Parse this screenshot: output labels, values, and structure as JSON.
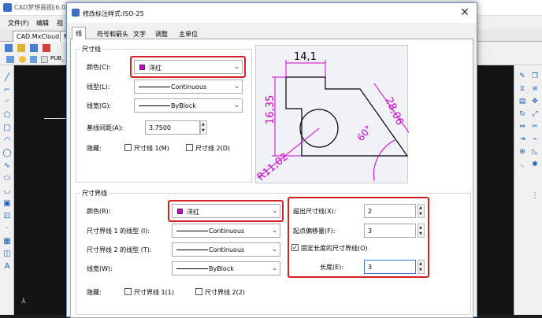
{
  "app": {
    "title": "CAD梦想画图(6.0.2",
    "menu": [
      "文件(F)",
      "编辑",
      "视"
    ],
    "doc_tabs": [
      "CAD.MxCloud",
      "M"
    ],
    "layer_name": "PUB_"
  },
  "dialog": {
    "title": "修改标注样式:ISO-25",
    "close_symbol": "✕",
    "tabs": [
      "线",
      "符号和箭头",
      "文字",
      "调整",
      "主单位"
    ],
    "active_tab": "线",
    "dimline": {
      "group_label": "尺寸线",
      "color_label": "颜色(C):",
      "color_value": "洋红",
      "color_hex": "#cc00cc",
      "linetype_label": "线型(L):",
      "linetype_value": "Continuous",
      "lineweight_label": "线宽(G):",
      "lineweight_value": "ByBlock",
      "baseline_label": "基线间距(A):",
      "baseline_value": "3.7500",
      "suppress_label": "隐藏:",
      "suppress_1": "尺寸线 1(M)",
      "suppress_2": "尺寸线 2(D)"
    },
    "extline": {
      "group_label": "尺寸界线",
      "color_label": "颜色(R):",
      "color_value": "洋红",
      "linetype1_label": "尺寸界线 1 的线型 (I):",
      "linetype1_value": "Continuous",
      "linetype2_label": "尺寸界线 2 的线型 (T):",
      "linetype2_value": "Continuous",
      "lineweight_label": "线宽(W):",
      "lineweight_value": "ByBlock",
      "suppress_label": "隐藏:",
      "suppress_1": "尺寸界线 1(1)",
      "suppress_2": "尺寸界线 2(2)",
      "extend_label": "超出尺寸线(X):",
      "extend_value": "2",
      "offset_label": "起点偏移量(F):",
      "offset_value": "3",
      "fixed_length_label": "固定长度的尺寸界线(O)",
      "fixed_length_checked": true,
      "length_label": "长度(E):",
      "length_value": "3"
    },
    "preview": {
      "dim_top": "14,1",
      "dim_left": "16,35",
      "dim_right": "28,06",
      "dim_angle": "60°",
      "dim_radius": "R11,02"
    }
  },
  "colors": {
    "accent_highlight": "#d42020",
    "dimension_magenta": "#cc00cc"
  }
}
